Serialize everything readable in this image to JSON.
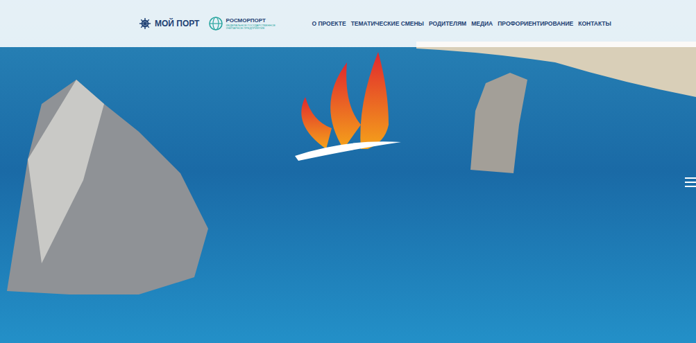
{
  "header": {
    "logos": [
      {
        "label": "МОЙ ПОРТ"
      },
      {
        "label": "РОСМОРПОРТ",
        "subtitle": "ФЕДЕРАЛЬНОЕ ГОСУДАРСТВЕННОЕ УНИТАРНОЕ ПРЕДПРИЯТИЕ"
      }
    ]
  },
  "nav": [
    {
      "label": "О ПРОЕКТЕ"
    },
    {
      "label": "ТЕМАТИЧЕСКИЕ СМЕНЫ"
    },
    {
      "label": "РОДИТЕЛЯМ"
    },
    {
      "label": "МЕДИА"
    },
    {
      "label": "ПРОФОРИЕНТИРОВАНИЕ"
    },
    {
      "label": "КОНТАКТЫ"
    }
  ]
}
